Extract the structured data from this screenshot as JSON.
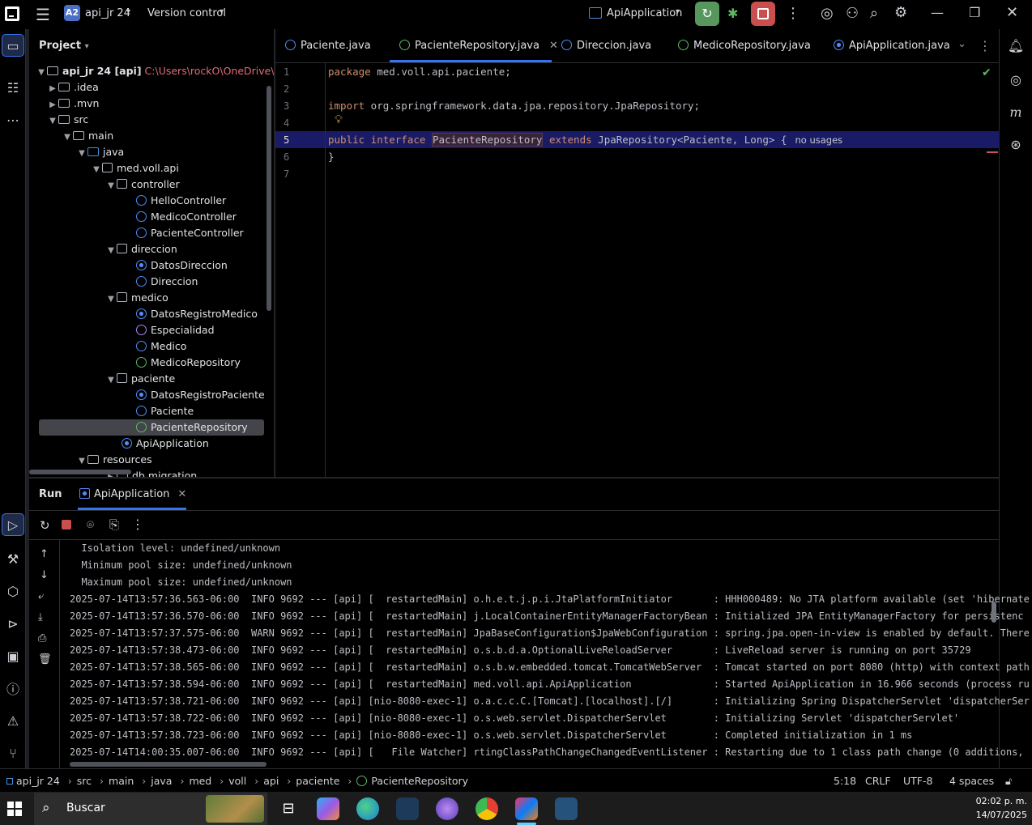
{
  "titlebar": {
    "project_badge": "A2",
    "project_name": "api_jr 24",
    "vcs": "Version control",
    "run_config": "ApiApplication"
  },
  "project_panel": {
    "title": "Project",
    "root_name": "api_jr 24 [api]",
    "root_path": "C:\\Users\\rockO\\OneDrive\\ORA",
    "items": [
      {
        "label": ".idea"
      },
      {
        "label": ".mvn"
      },
      {
        "label": "src"
      },
      {
        "label": "main"
      },
      {
        "label": "java"
      },
      {
        "label": "med.voll.api"
      },
      {
        "label": "controller"
      },
      {
        "label": "HelloController"
      },
      {
        "label": "MedicoController"
      },
      {
        "label": "PacienteController"
      },
      {
        "label": "direccion"
      },
      {
        "label": "DatosDireccion"
      },
      {
        "label": "Direccion"
      },
      {
        "label": "medico"
      },
      {
        "label": "DatosRegistroMedico"
      },
      {
        "label": "Especialidad"
      },
      {
        "label": "Medico"
      },
      {
        "label": "MedicoRepository"
      },
      {
        "label": "paciente"
      },
      {
        "label": "DatosRegistroPaciente"
      },
      {
        "label": "Paciente"
      },
      {
        "label": "PacienteRepository"
      },
      {
        "label": "ApiApplication"
      },
      {
        "label": "resources"
      },
      {
        "label": "db.migration"
      }
    ]
  },
  "editor": {
    "tabs": [
      {
        "label": "Paciente.java"
      },
      {
        "label": "PacienteRepository.java"
      },
      {
        "label": "Direccion.java"
      },
      {
        "label": "MedicoRepository.java"
      },
      {
        "label": "ApiApplication.java"
      }
    ],
    "line_numbers": [
      "1",
      "2",
      "3",
      "4",
      "5",
      "6",
      "7"
    ],
    "code": {
      "l1_kw": "package",
      "l1_rest": " med.voll.api.paciente;",
      "l3_kw": "import",
      "l3_rest": " org.springframework.data.jpa.repository.JpaRepository;",
      "l5_kw1": "public interface",
      "l5_ident": "PacienteRepository",
      "l5_kw2": "extends",
      "l5_rest": " JpaRepository<Paciente, Long> {",
      "l5_hint": "no usages",
      "l6": "}"
    }
  },
  "run_panel": {
    "title": "Run",
    "tab": "ApiApplication",
    "console_lines": [
      "  Isolation level: undefined/unknown",
      "  Minimum pool size: undefined/unknown",
      "  Maximum pool size: undefined/unknown",
      "2025-07-14T13:57:36.563-06:00  INFO 9692 --- [api] [  restartedMain] o.h.e.t.j.p.i.JtaPlatformInitiator       : HHH000489: No JTA platform available (set 'hibernate",
      "2025-07-14T13:57:36.570-06:00  INFO 9692 --- [api] [  restartedMain] j.LocalContainerEntityManagerFactoryBean : Initialized JPA EntityManagerFactory for persistenc",
      "2025-07-14T13:57:37.575-06:00  WARN 9692 --- [api] [  restartedMain] JpaBaseConfiguration$JpaWebConfiguration : spring.jpa.open-in-view is enabled by default. There",
      "2025-07-14T13:57:38.473-06:00  INFO 9692 --- [api] [  restartedMain] o.s.b.d.a.OptionalLiveReloadServer       : LiveReload server is running on port 35729",
      "2025-07-14T13:57:38.565-06:00  INFO 9692 --- [api] [  restartedMain] o.s.b.w.embedded.tomcat.TomcatWebServer  : Tomcat started on port 8080 (http) with context path",
      "2025-07-14T13:57:38.594-06:00  INFO 9692 --- [api] [  restartedMain] med.voll.api.ApiApplication              : Started ApiApplication in 16.966 seconds (process ru",
      "2025-07-14T13:57:38.721-06:00  INFO 9692 --- [api] [nio-8080-exec-1] o.a.c.c.C.[Tomcat].[localhost].[/]       : Initializing Spring DispatcherServlet 'dispatcherSer",
      "2025-07-14T13:57:38.722-06:00  INFO 9692 --- [api] [nio-8080-exec-1] o.s.web.servlet.DispatcherServlet        : Initializing Servlet 'dispatcherServlet'",
      "2025-07-14T13:57:38.723-06:00  INFO 9692 --- [api] [nio-8080-exec-1] o.s.web.servlet.DispatcherServlet        : Completed initialization in 1 ms",
      "2025-07-14T14:00:35.007-06:00  INFO 9692 --- [api] [   File Watcher] rtingClassPathChangeChangedEventListener : Restarting due to 1 class path change (0 additions,"
    ]
  },
  "statusbar": {
    "breadcrumb": [
      "api_jr 24",
      "src",
      "main",
      "java",
      "med",
      "voll",
      "api",
      "paciente",
      "PacienteRepository"
    ],
    "position": "5:18",
    "line_ending": "CRLF",
    "encoding": "UTF-8",
    "indent": "4 spaces"
  },
  "taskbar": {
    "search_placeholder": "Buscar",
    "time": "02:02 p. m.",
    "date": "14/07/2025"
  }
}
